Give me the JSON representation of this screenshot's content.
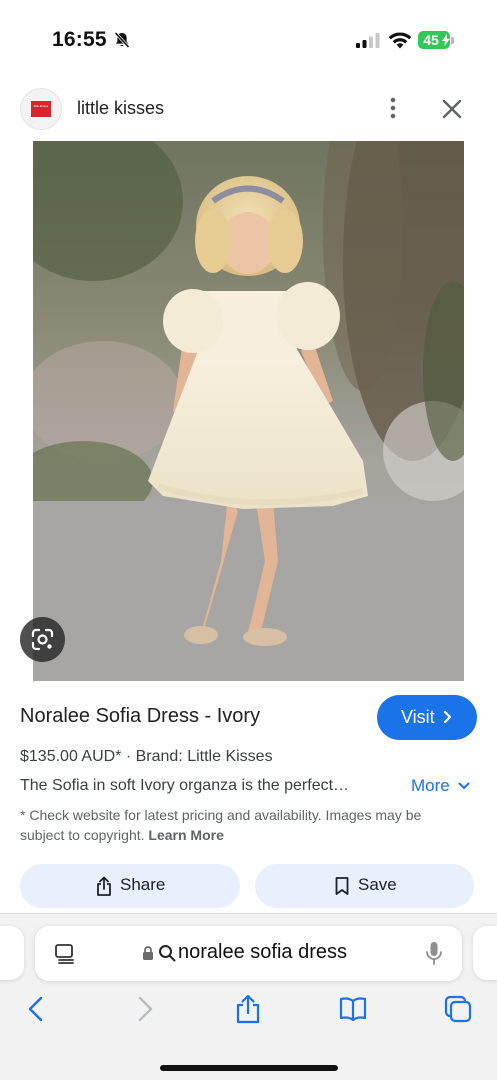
{
  "status_bar": {
    "time": "16:55",
    "battery": "45"
  },
  "source": {
    "logo_text": "little kisses",
    "name": "little kisses"
  },
  "product": {
    "title": "Noralee Sofia Dress - Ivory",
    "price_line": "$135.00 AUD* · Brand: Little Kisses",
    "description": "The Sofia in soft Ivory organza is the perfect…",
    "more_label": "More",
    "disclaimer": "* Check website for latest pricing and availability. Images may be subject to copyright.",
    "learn_more": "Learn More"
  },
  "visit_label": "Visit",
  "actions": {
    "share_label": "Share",
    "save_label": "Save"
  },
  "browser": {
    "address": "noralee sofia dress"
  },
  "colors": {
    "accent": "#1a73e8",
    "chip_background": "#e8f0fe",
    "battery_green": "#34c759"
  },
  "icons": [
    "bell-slash-icon",
    "signal-icon",
    "wifi-icon",
    "battery-icon",
    "more-vert-icon",
    "close-icon",
    "lens-search-icon",
    "chevron-right-icon",
    "chevron-down-icon",
    "share-icon",
    "bookmark-icon",
    "page-menu-icon",
    "lock-icon",
    "search-icon",
    "mic-icon",
    "back-icon",
    "forward-icon",
    "book-icon",
    "tabs-icon"
  ]
}
